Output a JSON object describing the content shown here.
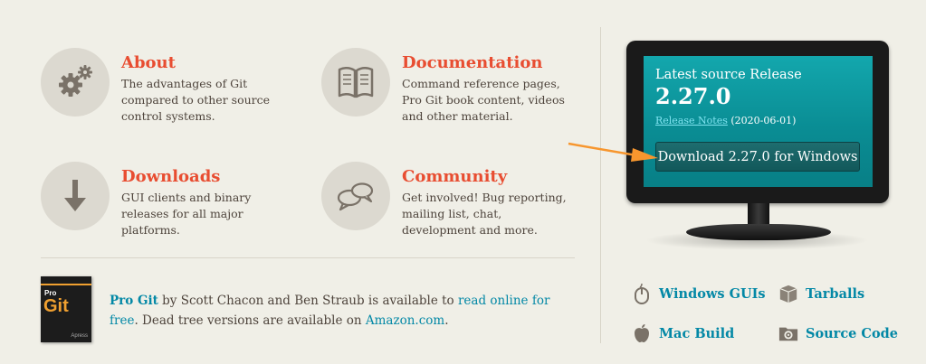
{
  "features": [
    {
      "id": "about",
      "title": "About",
      "desc": "The advantages of Git compared to other source control systems.",
      "icon": "gears-icon"
    },
    {
      "id": "documentation",
      "title": "Documentation",
      "desc": "Command reference pages, Pro Git book content, videos and other material.",
      "icon": "book-icon"
    },
    {
      "id": "downloads",
      "title": "Downloads",
      "desc": "GUI clients and binary releases for all major platforms.",
      "icon": "download-arrow-icon"
    },
    {
      "id": "community",
      "title": "Community",
      "desc": "Get involved! Bug reporting, mailing list, chat, development and more.",
      "icon": "chat-bubbles-icon"
    }
  ],
  "progit": {
    "title": "Pro Git",
    "text1": " by Scott Chacon and Ben Straub is available to ",
    "read_link": "read online for free",
    "text2": ". Dead tree versions are available on ",
    "amazon_link": "Amazon.com",
    "text3": ".",
    "cover": {
      "pro": "Pro",
      "git": "Git",
      "publisher": "Apress"
    }
  },
  "release": {
    "heading": "Latest source Release",
    "version": "2.27.0",
    "notes_label": "Release Notes",
    "date": "(2020-06-01)",
    "download_button": "Download 2.27.0 for Windows"
  },
  "links": {
    "windows_guis": "Windows GUIs",
    "tarballs": "Tarballs",
    "mac_build": "Mac Build",
    "source_code": "Source Code"
  },
  "colors": {
    "accent": "#e84d31",
    "link": "#0388a6",
    "screen": "#0a8d94",
    "arrow": "#f7962e"
  }
}
